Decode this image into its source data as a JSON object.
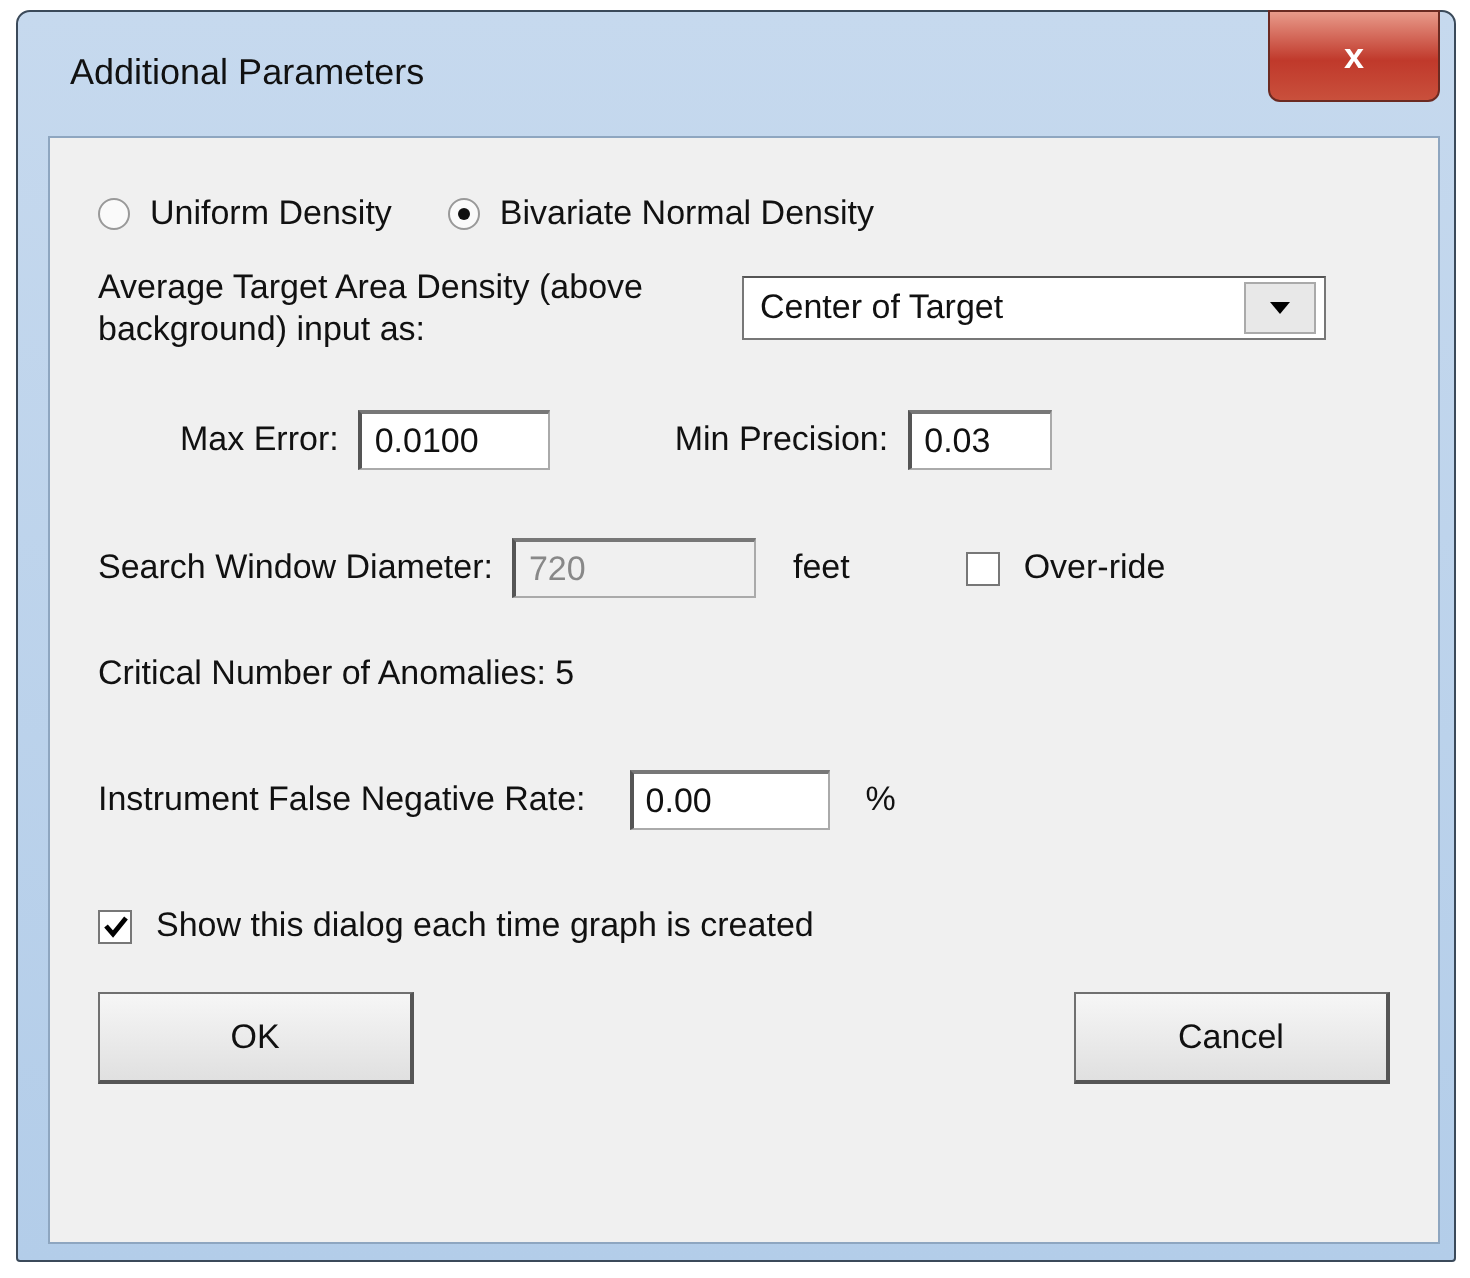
{
  "window": {
    "title": "Additional Parameters",
    "close": "x"
  },
  "density_options": [
    {
      "label": "Uniform Density",
      "selected": false
    },
    {
      "label": "Bivariate Normal Density",
      "selected": true
    }
  ],
  "input_mode": {
    "label": "Average Target Area Density (above background) input as:",
    "value": "Center of Target"
  },
  "max_error": {
    "label": "Max Error:",
    "value": "0.0100"
  },
  "min_precision": {
    "label": "Min Precision:",
    "value": "0.03"
  },
  "search_window": {
    "label": "Search Window Diameter:",
    "value": "720",
    "disabled": true,
    "unit": "feet"
  },
  "override": {
    "label": "Over-ride",
    "checked": false
  },
  "critical_anomalies": "Critical Number of Anomalies: 5",
  "false_negative": {
    "label": "Instrument False Negative Rate:",
    "value": "0.00",
    "unit": "%"
  },
  "show_dialog": {
    "label": "Show this dialog each time graph is created",
    "checked": true
  },
  "buttons": [
    {
      "label": "OK"
    },
    {
      "label": "Cancel"
    }
  ]
}
